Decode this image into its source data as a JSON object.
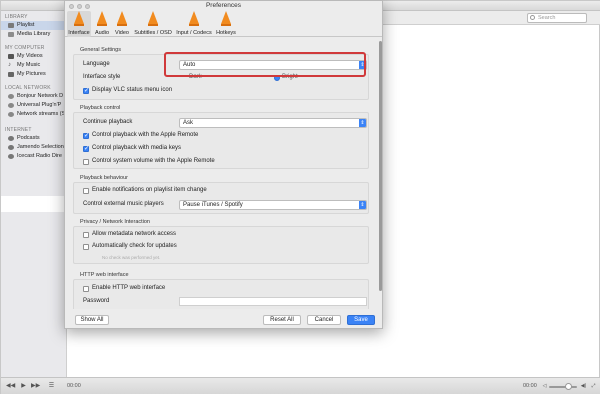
{
  "vlc": {
    "search_placeholder": "Search",
    "sidebar": {
      "sections": {
        "library": "LIBRARY",
        "my_computer": "MY COMPUTER",
        "local_network": "LOCAL NETWORK",
        "internet": "INTERNET"
      },
      "library_items": [
        "Playlist",
        "Media Library"
      ],
      "computer_items": [
        "My Videos",
        "My Music",
        "My Pictures"
      ],
      "network_items": [
        "Bonjour Network D",
        "Universal Plug'n'P",
        "Network streams (S"
      ],
      "internet_items": [
        "Podcasts",
        "Jamendo Selection",
        "Icecast Radio Dire"
      ]
    },
    "controls": {
      "time_start": "00:00",
      "time_end": "00:00"
    }
  },
  "prefs": {
    "title": "Preferences",
    "tabs": [
      "Interface",
      "Audio",
      "Video",
      "Subtitles / OSD",
      "Input / Codecs",
      "Hotkeys"
    ],
    "general": {
      "title": "General Settings",
      "language_label": "Language",
      "language_value": "Auto",
      "style_label": "Interface style",
      "style_dark": "Dark",
      "style_bright": "Bright",
      "status_icon_label": "Display VLC status menu icon"
    },
    "playback": {
      "title": "Playback control",
      "continue_label": "Continue playback",
      "continue_value": "Ask",
      "apple_remote": "Control playback with the Apple Remote",
      "media_keys": "Control playback with media keys",
      "system_volume": "Control system volume with the Apple Remote"
    },
    "behaviour": {
      "title": "Playback behaviour",
      "notifications": "Enable notifications on playlist item change",
      "external_label": "Control external music players",
      "external_value": "Pause iTunes / Spotify"
    },
    "privacy": {
      "title": "Privacy / Network Interaction",
      "metadata": "Allow metadata network access",
      "updates": "Automatically check for updates",
      "updates_hint": "No check was performed yet."
    },
    "http": {
      "title": "HTTP web interface",
      "enable": "Enable HTTP web interface",
      "password_label": "Password"
    },
    "buttons": {
      "show_all": "Show All",
      "reset_all": "Reset All",
      "cancel": "Cancel",
      "save": "Save"
    }
  },
  "colors": {
    "accent": "#3b83f6",
    "highlight": "#d0393a",
    "vlc_orange": "#f18b1f"
  }
}
